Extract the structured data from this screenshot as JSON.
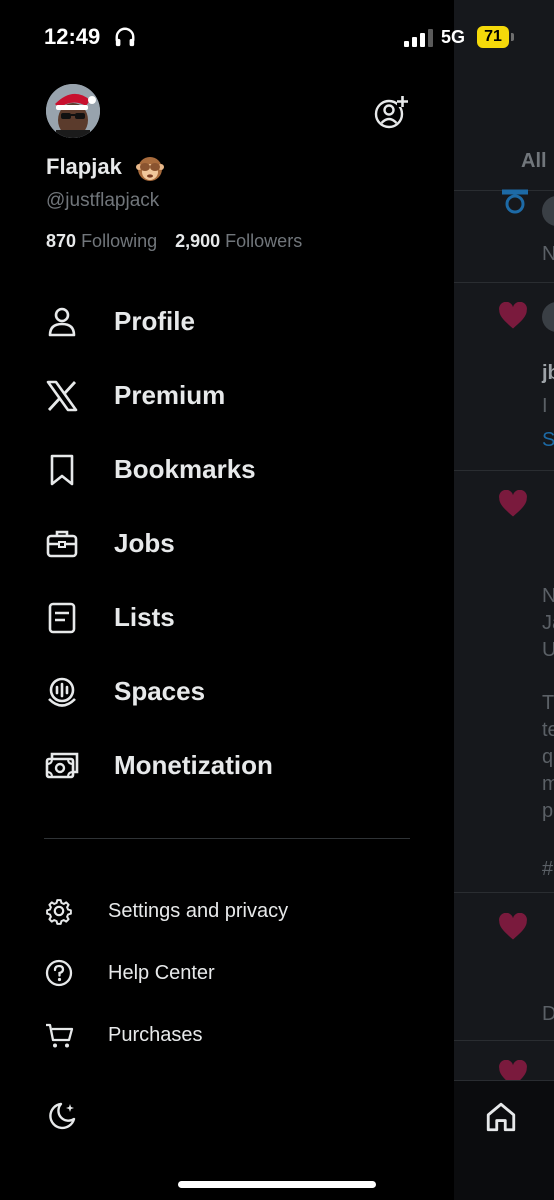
{
  "status_bar": {
    "time": "12:49",
    "network": "5G",
    "battery": "71"
  },
  "profile": {
    "name": "Flapjak",
    "handle": "@justflapjack",
    "following_count": "870",
    "following_label": "Following",
    "followers_count": "2,900",
    "followers_label": "Followers"
  },
  "menu": {
    "profile": "Profile",
    "premium": "Premium",
    "bookmarks": "Bookmarks",
    "jobs": "Jobs",
    "lists": "Lists",
    "spaces": "Spaces",
    "monetization": "Monetization"
  },
  "secondary_menu": {
    "settings": "Settings and privacy",
    "help": "Help Center",
    "purchases": "Purchases"
  },
  "feed": {
    "tab_all": "All",
    "snippets": [
      "N",
      "jb",
      "I",
      "S",
      "N",
      "Ja",
      "U",
      "T",
      "te",
      "q",
      "m",
      "p",
      "#",
      "D"
    ]
  },
  "colors": {
    "accent_heart": "#7a1a3d",
    "battery": "#f5d90a",
    "link": "#1d6aa6"
  }
}
